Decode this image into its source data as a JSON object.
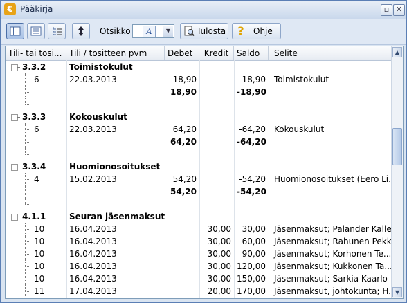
{
  "window": {
    "title": "Pääkirja",
    "app_icon": "€",
    "min_glyph": "▫",
    "close_glyph": "✕"
  },
  "toolbar": {
    "otsikko_label": "Otsikko",
    "otsikko_value": "A",
    "print_label": "Tulosta",
    "help_label": "Ohje",
    "help_glyph": "?"
  },
  "table": {
    "columns": [
      "Tili- tai tosi...",
      "Tili / tositteen pvm",
      "Debet",
      "Kredit",
      "Saldo",
      "Selite"
    ],
    "rows": [
      {
        "type": "account",
        "code": "3.3.2",
        "name": "Toimistokulut"
      },
      {
        "type": "entry",
        "doc": "6",
        "date": "22.03.2013",
        "debet": "18,90",
        "kredit": "",
        "saldo": "-18,90",
        "selite": "Toimistokulut"
      },
      {
        "type": "total",
        "debet": "18,90",
        "saldo": "-18,90"
      },
      {
        "type": "blank"
      },
      {
        "type": "account",
        "code": "3.3.3",
        "name": "Kokouskulut"
      },
      {
        "type": "entry",
        "doc": "6",
        "date": "22.03.2013",
        "debet": "64,20",
        "kredit": "",
        "saldo": "-64,20",
        "selite": "Kokouskulut"
      },
      {
        "type": "total",
        "debet": "64,20",
        "saldo": "-64,20"
      },
      {
        "type": "blank"
      },
      {
        "type": "account",
        "code": "3.3.4",
        "name": "Huomionosoitukset"
      },
      {
        "type": "entry",
        "doc": "4",
        "date": "15.02.2013",
        "debet": "54,20",
        "kredit": "",
        "saldo": "-54,20",
        "selite": "Huomionosoitukset (Eero Li..."
      },
      {
        "type": "total",
        "debet": "54,20",
        "saldo": "-54,20"
      },
      {
        "type": "blank"
      },
      {
        "type": "account",
        "code": "4.1.1",
        "name": "Seuran jäsenmaksut"
      },
      {
        "type": "entry",
        "doc": "10",
        "date": "16.04.2013",
        "debet": "",
        "kredit": "30,00",
        "saldo": "30,00",
        "selite": "Jäsenmaksut; Palander Kalle"
      },
      {
        "type": "entry",
        "doc": "10",
        "date": "16.04.2013",
        "debet": "",
        "kredit": "30,00",
        "saldo": "60,00",
        "selite": "Jäsenmaksut; Rahunen Pekka"
      },
      {
        "type": "entry",
        "doc": "10",
        "date": "16.04.2013",
        "debet": "",
        "kredit": "30,00",
        "saldo": "90,00",
        "selite": "Jäsenmaksut; Korhonen Te..."
      },
      {
        "type": "entry",
        "doc": "10",
        "date": "16.04.2013",
        "debet": "",
        "kredit": "30,00",
        "saldo": "120,00",
        "selite": "Jäsenmaksut; Kukkonen Ta..."
      },
      {
        "type": "entry",
        "doc": "10",
        "date": "16.04.2013",
        "debet": "",
        "kredit": "30,00",
        "saldo": "150,00",
        "selite": "Jäsenmaksut; Sarkia Kaarlo"
      },
      {
        "type": "entry",
        "doc": "11",
        "date": "17.04.2013",
        "debet": "",
        "kredit": "20,00",
        "saldo": "170,00",
        "selite": "Jäsenmaksut, johtokunta; H..."
      }
    ]
  },
  "scrollbar": {
    "up_glyph": "▲",
    "down_glyph": "▼"
  }
}
